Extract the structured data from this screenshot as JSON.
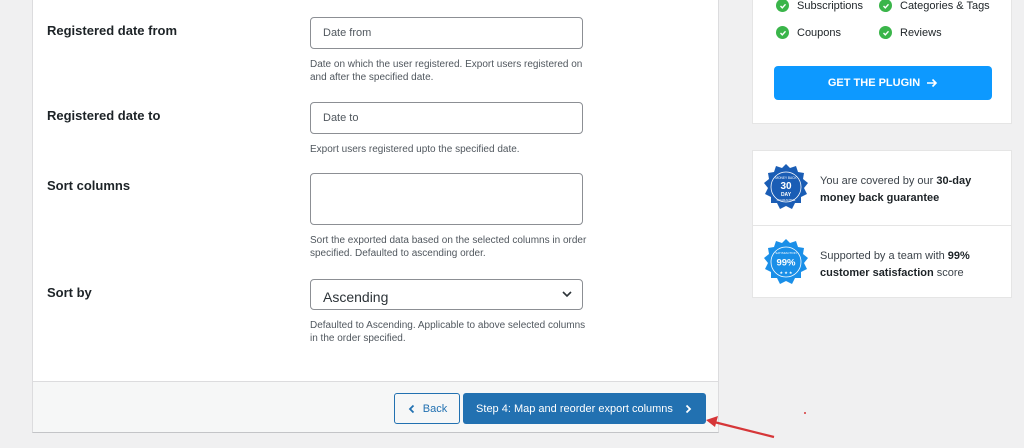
{
  "form": {
    "registered_from": {
      "label": "Registered date from",
      "placeholder": "Date from",
      "description": "Date on which the user registered. Export users registered on and after the specified date."
    },
    "registered_to": {
      "label": "Registered date to",
      "placeholder": "Date to",
      "description": "Export users registered upto the specified date."
    },
    "sort_columns": {
      "label": "Sort columns",
      "description": "Sort the exported data based on the selected columns in order specified. Defaulted to ascending order."
    },
    "sort_by": {
      "label": "Sort by",
      "value": "Ascending",
      "description": "Defaulted to Ascending. Applicable to above selected columns in the order specified."
    }
  },
  "footer": {
    "back_label": "Back",
    "next_label": "Step 4: Map and reorder export columns"
  },
  "promo": {
    "features": [
      "Subscriptions",
      "Categories & Tags",
      "Coupons",
      "Reviews"
    ],
    "button_label": "GET THE PLUGIN"
  },
  "guarantee": {
    "money_back": {
      "prefix": "You are covered by our ",
      "bold": "30-day money back guarantee",
      "badge_top": "MONEY BACK",
      "badge_main": "30",
      "badge_sub": "DAY",
      "badge_bottom": "GUARANTEE"
    },
    "satisfaction": {
      "prefix": "Supported by a team with ",
      "bold": "99% customer satisfaction",
      "suffix": " score",
      "badge_main": "99%",
      "badge_ring": "SATISFACTION"
    }
  },
  "colors": {
    "primary": "#2271b1",
    "plugin_button": "#0d99ff",
    "check": "#3ab54a",
    "badge": "#1a5db5",
    "annotation": "#d63638"
  },
  "icons": {
    "back": "chevron-left-icon",
    "next": "chevron-right-icon",
    "select": "chevron-down-icon",
    "check": "check-circle-icon",
    "plugin": "arrow-right-icon"
  }
}
